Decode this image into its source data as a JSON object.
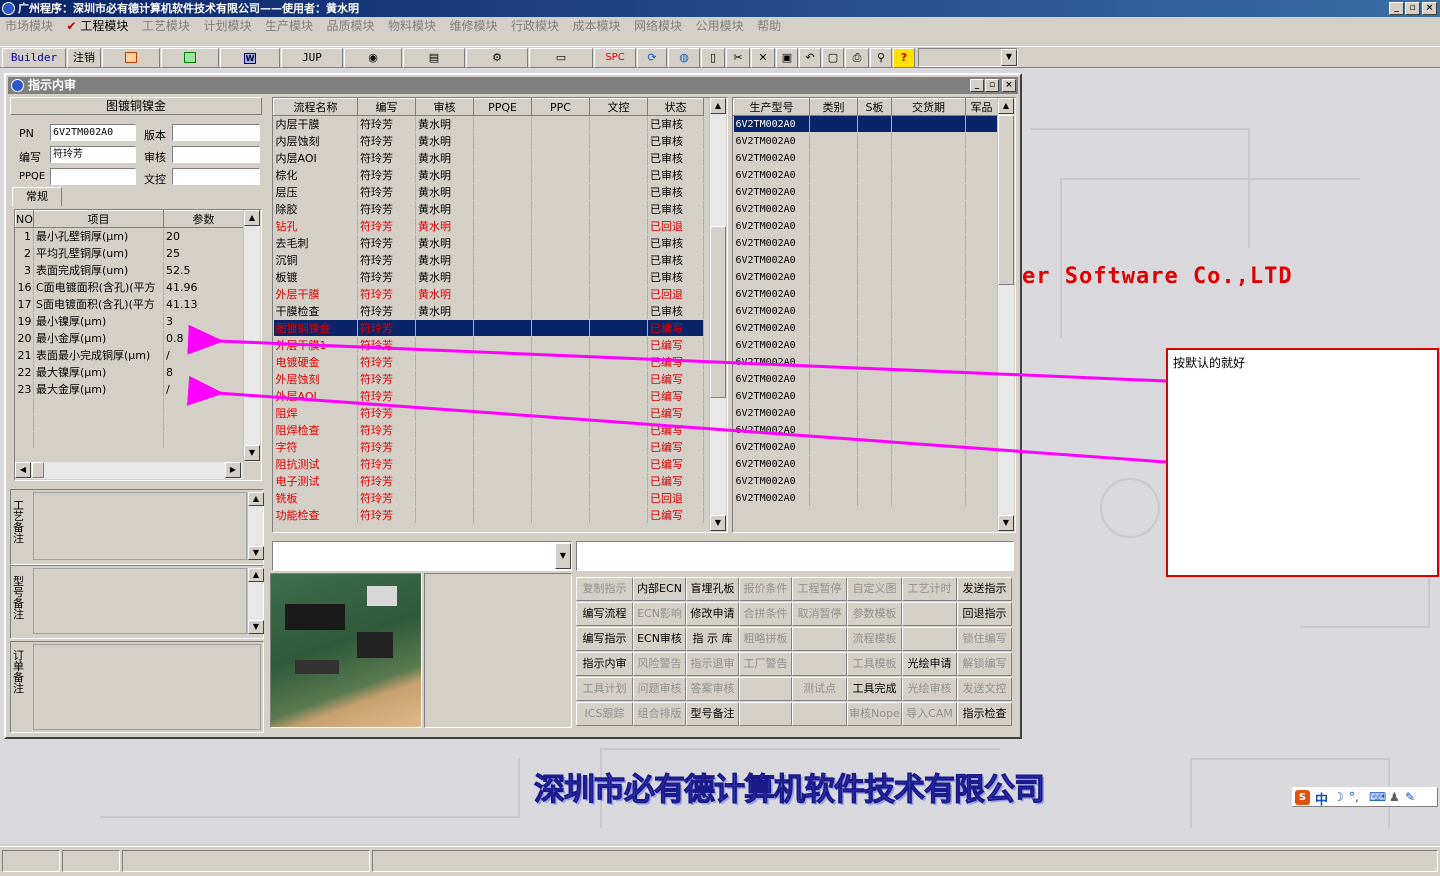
{
  "app": {
    "title": "广州程序：深圳市必有德计算机软件技术有限公司——使用者：黄水明",
    "window_buttons": [
      "_",
      "▫",
      "×"
    ]
  },
  "menu": [
    "市场模块",
    "工程模块",
    "工艺模块",
    "计划模块",
    "生产模块",
    "品质模块",
    "物料模块",
    "维修模块",
    "行政模块",
    "成本模块",
    "网络模块",
    "公用模块",
    "帮助"
  ],
  "toolbar": {
    "builder": "Builder",
    "logout": "注销",
    "jup": "JUP",
    "spc": "SPC",
    "help": "?",
    "combo_value": ""
  },
  "child": {
    "title": "指示内审"
  },
  "left": {
    "section_title": "图镀铜镍金",
    "pn_label": "PN",
    "pn_value": "6V2TM002A0",
    "version_label": "版本",
    "version_value": "",
    "writer_label": "编写",
    "writer_value": "符玲芳",
    "review_label": "审核",
    "review_value": "",
    "ppqe_label": "PPQE",
    "ppqe_value": "",
    "doc_label": "文控",
    "doc_value": "",
    "tab": "常规",
    "param_headers": [
      "NO",
      "项目",
      "参数"
    ],
    "params": [
      {
        "no": "1",
        "item": "最小孔壁铜厚(μm)",
        "value": "20"
      },
      {
        "no": "2",
        "item": "平均孔壁铜厚(um)",
        "value": "25"
      },
      {
        "no": "3",
        "item": "表面完成铜厚(um)",
        "value": "52.5"
      },
      {
        "no": "16",
        "item": "C面电镀面积(含孔)(平方",
        "value": "41.96"
      },
      {
        "no": "17",
        "item": "S面电镀面积(含孔)(平方",
        "value": "41.13"
      },
      {
        "no": "19",
        "item": "最小镍厚(μm)",
        "value": "3"
      },
      {
        "no": "20",
        "item": "最小金厚(μm)",
        "value": "0.8"
      },
      {
        "no": "21",
        "item": "表面最小完成铜厚(μm)",
        "value": "/"
      },
      {
        "no": "22",
        "item": "最大镍厚(μm)",
        "value": "8"
      },
      {
        "no": "23",
        "item": "最大金厚(μm)",
        "value": "/"
      }
    ],
    "remark_process": "工艺备注",
    "remark_model": "型号备注",
    "remark_order": "订单备注"
  },
  "flow": {
    "headers": [
      "流程名称",
      "编写",
      "审核",
      "PPQE",
      "PPC",
      "文控",
      "状态"
    ],
    "rows": [
      {
        "name": "内层干膜",
        "w": "符玲芳",
        "r": "黄水明",
        "s": "已审核",
        "t": "n"
      },
      {
        "name": "内层蚀刻",
        "w": "符玲芳",
        "r": "黄水明",
        "s": "已审核",
        "t": "n"
      },
      {
        "name": "内层AOI",
        "w": "符玲芳",
        "r": "黄水明",
        "s": "已审核",
        "t": "n"
      },
      {
        "name": "棕化",
        "w": "符玲芳",
        "r": "黄水明",
        "s": "已审核",
        "t": "n"
      },
      {
        "name": "层压",
        "w": "符玲芳",
        "r": "黄水明",
        "s": "已审核",
        "t": "n"
      },
      {
        "name": "除胶",
        "w": "符玲芳",
        "r": "黄水明",
        "s": "已审核",
        "t": "n"
      },
      {
        "name": "钻孔",
        "w": "符玲芳",
        "r": "黄水明",
        "s": "已回退",
        "t": "r"
      },
      {
        "name": "去毛刺",
        "w": "符玲芳",
        "r": "黄水明",
        "s": "已审核",
        "t": "n"
      },
      {
        "name": "沉铜",
        "w": "符玲芳",
        "r": "黄水明",
        "s": "已审核",
        "t": "n"
      },
      {
        "name": "板镀",
        "w": "符玲芳",
        "r": "黄水明",
        "s": "已审核",
        "t": "n"
      },
      {
        "name": "外层干膜",
        "w": "符玲芳",
        "r": "黄水明",
        "s": "已回退",
        "t": "r"
      },
      {
        "name": "干膜检查",
        "w": "符玲芳",
        "r": "黄水明",
        "s": "已审核",
        "t": "n"
      },
      {
        "name": "图镀铜镍金",
        "w": "符玲芳",
        "r": "",
        "s": "已编写",
        "t": "s"
      },
      {
        "name": "外层干膜1",
        "w": "符玲芳",
        "r": "",
        "s": "已编写",
        "t": "r"
      },
      {
        "name": "电镀硬金",
        "w": "符玲芳",
        "r": "",
        "s": "已编写",
        "t": "r"
      },
      {
        "name": "外层蚀刻",
        "w": "符玲芳",
        "r": "",
        "s": "已编写",
        "t": "r"
      },
      {
        "name": "外层AOI",
        "w": "符玲芳",
        "r": "",
        "s": "已编写",
        "t": "r"
      },
      {
        "name": "阻焊",
        "w": "符玲芳",
        "r": "",
        "s": "已编写",
        "t": "r"
      },
      {
        "name": "阻焊检查",
        "w": "符玲芳",
        "r": "",
        "s": "已编写",
        "t": "r"
      },
      {
        "name": "字符",
        "w": "符玲芳",
        "r": "",
        "s": "已编写",
        "t": "r"
      },
      {
        "name": "阻抗测试",
        "w": "符玲芳",
        "r": "",
        "s": "已编写",
        "t": "r"
      },
      {
        "name": "电子测试",
        "w": "符玲芳",
        "r": "",
        "s": "已编写",
        "t": "r"
      },
      {
        "name": "铣板",
        "w": "符玲芳",
        "r": "",
        "s": "已回退",
        "t": "r"
      },
      {
        "name": "功能检查",
        "w": "符玲芳",
        "r": "",
        "s": "已编写",
        "t": "r"
      }
    ]
  },
  "models": {
    "headers": [
      "生产型号",
      "类别",
      "S板",
      "交货期",
      "军品"
    ],
    "rows": [
      "6V2TM002A0",
      "6V2TM002A0",
      "6V2TM002A0",
      "6V2TM002A0",
      "6V2TM002A0",
      "6V2TM002A0",
      "6V2TM002A0",
      "6V2TM002A0",
      "6V2TM002A0",
      "6V2TM002A0",
      "6V2TM002A0",
      "6V2TM002A0",
      "6V2TM002A0",
      "6V2TM002A0",
      "6V2TM002A0",
      "6V2TM002A0",
      "6V2TM002A0",
      "6V2TM002A0",
      "6V2TM002A0",
      "6V2TM002A0",
      "6V2TM002A0",
      "6V2TM002A0",
      "6V2TM002A0"
    ]
  },
  "actions": [
    [
      {
        "l": "复制指示",
        "on": false
      },
      {
        "l": "内部ECN",
        "on": true
      },
      {
        "l": "盲埋孔板",
        "on": true
      },
      {
        "l": "报价条件",
        "on": false
      },
      {
        "l": "工程暂停",
        "on": false
      },
      {
        "l": "自定义图",
        "on": false
      },
      {
        "l": "工艺计时",
        "on": false
      },
      {
        "l": "发送指示",
        "on": true
      }
    ],
    [
      {
        "l": "编写流程",
        "on": true
      },
      {
        "l": "ECN影响",
        "on": false
      },
      {
        "l": "修改申请",
        "on": true
      },
      {
        "l": "合拼条件",
        "on": false
      },
      {
        "l": "取消暂停",
        "on": false
      },
      {
        "l": "参数模板",
        "on": false
      },
      {
        "l": "",
        "on": false
      },
      {
        "l": "回退指示",
        "on": true
      }
    ],
    [
      {
        "l": "编写指示",
        "on": true
      },
      {
        "l": "ECN审核",
        "on": true
      },
      {
        "l": "指 示 库",
        "on": true
      },
      {
        "l": "粗略拼板",
        "on": false
      },
      {
        "l": "",
        "on": false
      },
      {
        "l": "流程模板",
        "on": false
      },
      {
        "l": "",
        "on": false
      },
      {
        "l": "锁住编写",
        "on": false
      }
    ],
    [
      {
        "l": "指示内审",
        "on": true
      },
      {
        "l": "风险警告",
        "on": false
      },
      {
        "l": "指示退审",
        "on": false
      },
      {
        "l": "工厂警告",
        "on": false
      },
      {
        "l": "",
        "on": false
      },
      {
        "l": "工具模板",
        "on": false
      },
      {
        "l": "光绘申请",
        "on": true
      },
      {
        "l": "解锁编写",
        "on": false
      }
    ],
    [
      {
        "l": "工具计划",
        "on": false
      },
      {
        "l": "问题审核",
        "on": false
      },
      {
        "l": "答案审核",
        "on": false
      },
      {
        "l": "",
        "on": false
      },
      {
        "l": "测试点",
        "on": false
      },
      {
        "l": "工具完成",
        "on": true
      },
      {
        "l": "光绘审核",
        "on": false
      },
      {
        "l": "发送文控",
        "on": false
      }
    ],
    [
      {
        "l": "ICS跟踪",
        "on": false
      },
      {
        "l": "组合排版",
        "on": false
      },
      {
        "l": "型号备注",
        "on": true
      },
      {
        "l": "",
        "on": false
      },
      {
        "l": "",
        "on": false
      },
      {
        "l": "审核Nope",
        "on": false
      },
      {
        "l": "导入CAM",
        "on": false
      },
      {
        "l": "指示检查",
        "on": true
      }
    ]
  ],
  "background": {
    "software_text": "er Software Co.,LTD",
    "company_text": "深圳市必有德计算机软件技术有限公司"
  },
  "callout": {
    "text": "按默认的就好"
  },
  "ime": {
    "label": "中"
  },
  "colors": {
    "accent": "#0a246a",
    "arrow": "#ff00ff",
    "red": "#e00000"
  }
}
